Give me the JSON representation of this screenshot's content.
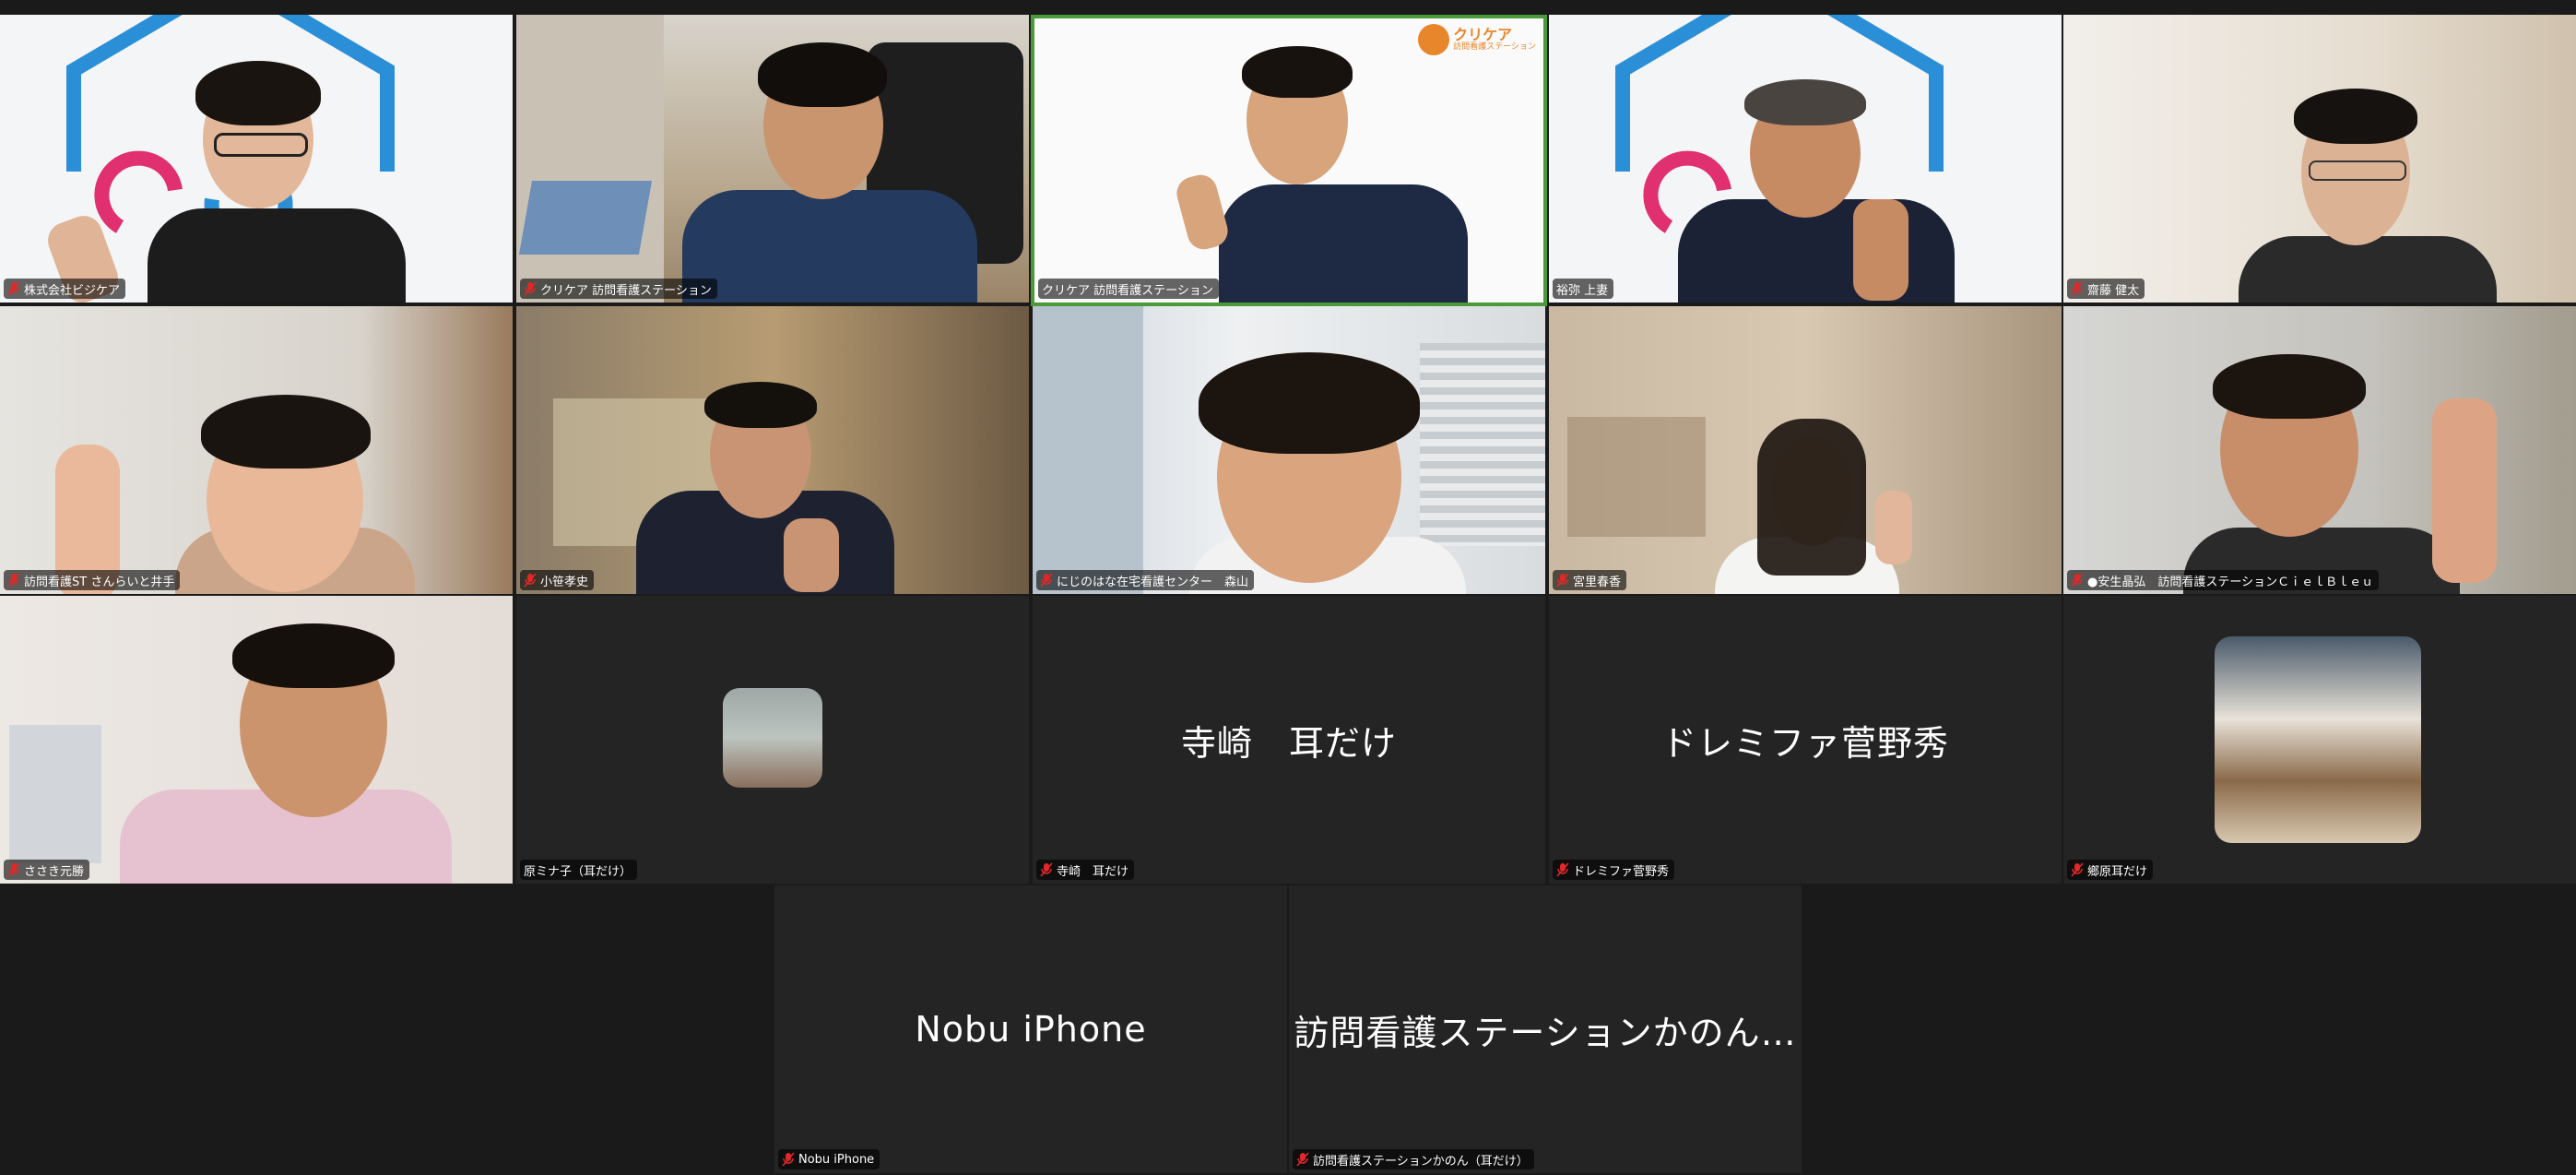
{
  "participants": [
    {
      "name": "株式会社ビジケア",
      "muted": true
    },
    {
      "name": "クリケア 訪問看護ステーション",
      "muted": true
    },
    {
      "name": "クリケア 訪問看護ステーション",
      "muted": false
    },
    {
      "name": "裕弥 上妻",
      "muted": false
    },
    {
      "name": "齋藤 健太",
      "muted": true
    },
    {
      "name": "訪問看護ST さんらいと井手",
      "muted": true
    },
    {
      "name": "小笹孝史",
      "muted": true
    },
    {
      "name": "にじのはな在宅看護センター　森山",
      "muted": true
    },
    {
      "name": "宮里春香",
      "muted": true
    },
    {
      "name": "●安生晶弘　訪問看護ステーションＣｉｅｌＢｌｅｕ",
      "muted": true
    },
    {
      "name": "ささき元勝",
      "muted": true
    },
    {
      "name": "原ミナ子（耳だけ）",
      "muted": false
    },
    {
      "name": "寺崎　耳だけ",
      "display": "寺崎　耳だけ",
      "muted": true
    },
    {
      "name": "ドレミファ菅野秀",
      "display": "ドレミファ菅野秀",
      "muted": true
    },
    {
      "name": "鄉原耳だけ",
      "muted": true
    },
    {
      "name": "Nobu iPhone",
      "display": "Nobu iPhone",
      "muted": true
    },
    {
      "name": "訪問看護ステーションかのん（耳だけ）",
      "display": "訪問看護ステーションかのん…",
      "muted": true
    }
  ],
  "logo_text": {
    "line1": "クリケア",
    "line2": "訪問看護ステーション"
  },
  "colors": {
    "active_border": "#4a9a3a",
    "tile_bg": "#242424",
    "stage_bg": "#1a1a1a"
  }
}
